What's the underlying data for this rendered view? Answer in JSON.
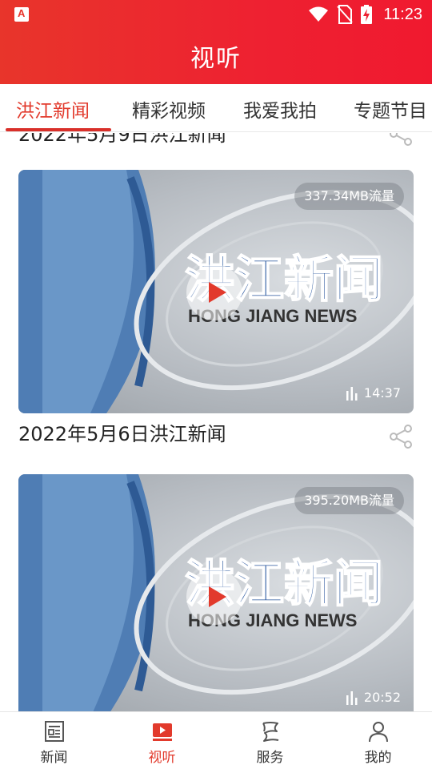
{
  "status_bar": {
    "time": "11:23"
  },
  "header": {
    "title": "视听"
  },
  "tabs": [
    {
      "label": "洪江新闻",
      "active": true
    },
    {
      "label": "精彩视频",
      "active": false
    },
    {
      "label": "我爱我拍",
      "active": false
    },
    {
      "label": "专题节目",
      "active": false
    }
  ],
  "feed": {
    "partial_title": "2022年5月9日洪江新闻",
    "videos": [
      {
        "size": "337.34MB流量",
        "duration": "14:37",
        "title": "2022年5月6日洪江新闻",
        "thumb_logo": "洪江新闻",
        "thumb_sub": "HONG JIANG NEWS"
      },
      {
        "size": "395.20MB流量",
        "duration": "20:52",
        "title": "",
        "thumb_logo": "洪江新闻",
        "thumb_sub": "HONG JIANG NEWS"
      }
    ]
  },
  "bottom_nav": [
    {
      "label": "新闻",
      "icon": "newspaper-icon",
      "active": false
    },
    {
      "label": "视听",
      "icon": "video-play-icon",
      "active": true
    },
    {
      "label": "服务",
      "icon": "scroll-icon",
      "active": false
    },
    {
      "label": "我的",
      "icon": "person-icon",
      "active": false
    }
  ],
  "colors": {
    "accent": "#e23a2c",
    "header": "#ee2131"
  }
}
